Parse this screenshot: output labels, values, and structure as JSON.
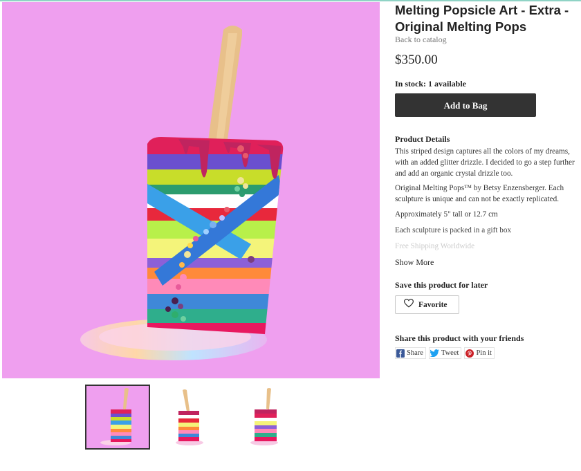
{
  "product": {
    "title": "Melting Popsicle Art - Extra - Original Melting Pops",
    "back_link": "Back to catalog",
    "price": "$350.00",
    "stock": "In stock: 1 available",
    "add_to_bag": "Add to Bag"
  },
  "details": {
    "heading": "Product Details",
    "paragraphs": [
      "This striped design captures all the colors of my dreams, with an added glitter drizzle. I decided to go a step further and add an organic crystal drizzle too.",
      "Original Melting Pops™ by Betsy Enzensberger. Each sculpture is unique and can not be exactly replicated.",
      "Approximately 5\" tall or 12.7 cm",
      "Each sculpture is packed in a gift box",
      "Free Shipping Worldwide"
    ],
    "show_more": "Show More"
  },
  "save": {
    "heading": "Save this product for later",
    "favorite_label": "Favorite",
    "icon": "heart-icon"
  },
  "share": {
    "heading": "Share this product with your friends",
    "buttons": [
      {
        "label": "Share",
        "icon": "facebook-icon",
        "color": "#3b5998"
      },
      {
        "label": "Tweet",
        "icon": "twitter-icon",
        "color": "#1da1f2"
      },
      {
        "label": "Pin it",
        "icon": "pinterest-icon",
        "color": "#cb2027"
      }
    ]
  },
  "gallery": {
    "background_color": "#ef9fef",
    "thumbnails": 3,
    "selected_index": 0
  }
}
